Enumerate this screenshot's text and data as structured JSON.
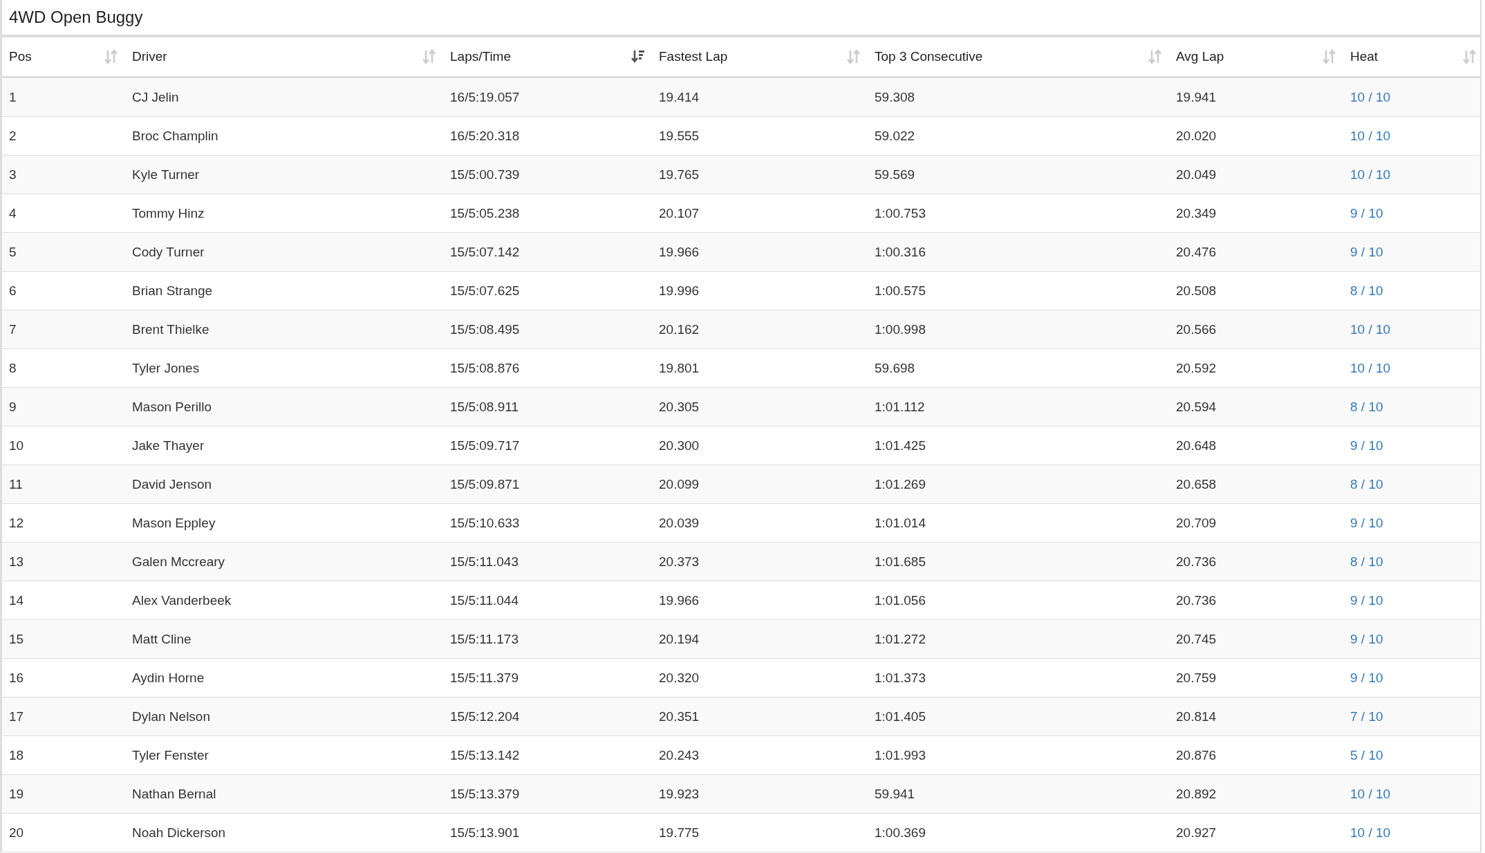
{
  "title": "4WD Open Buggy",
  "columns": [
    {
      "label": "Pos",
      "sorted": false
    },
    {
      "label": "Driver",
      "sorted": false
    },
    {
      "label": "Laps/Time",
      "sorted": true
    },
    {
      "label": "Fastest Lap",
      "sorted": false
    },
    {
      "label": "Top 3 Consecutive",
      "sorted": false
    },
    {
      "label": "Avg Lap",
      "sorted": false
    },
    {
      "label": "Heat",
      "sorted": false
    }
  ],
  "rows": [
    [
      "1",
      "CJ Jelin",
      "16/5:19.057",
      "19.414",
      "59.308",
      "19.941",
      "10 / 10"
    ],
    [
      "2",
      "Broc Champlin",
      "16/5:20.318",
      "19.555",
      "59.022",
      "20.020",
      "10 / 10"
    ],
    [
      "3",
      "Kyle Turner",
      "15/5:00.739",
      "19.765",
      "59.569",
      "20.049",
      "10 / 10"
    ],
    [
      "4",
      "Tommy Hinz",
      "15/5:05.238",
      "20.107",
      "1:00.753",
      "20.349",
      "9 / 10"
    ],
    [
      "5",
      "Cody Turner",
      "15/5:07.142",
      "19.966",
      "1:00.316",
      "20.476",
      "9 / 10"
    ],
    [
      "6",
      "Brian Strange",
      "15/5:07.625",
      "19.996",
      "1:00.575",
      "20.508",
      "8 / 10"
    ],
    [
      "7",
      "Brent Thielke",
      "15/5:08.495",
      "20.162",
      "1:00.998",
      "20.566",
      "10 / 10"
    ],
    [
      "8",
      "Tyler Jones",
      "15/5:08.876",
      "19.801",
      "59.698",
      "20.592",
      "10 / 10"
    ],
    [
      "9",
      "Mason Perillo",
      "15/5:08.911",
      "20.305",
      "1:01.112",
      "20.594",
      "8 / 10"
    ],
    [
      "10",
      "Jake Thayer",
      "15/5:09.717",
      "20.300",
      "1:01.425",
      "20.648",
      "9 / 10"
    ],
    [
      "11",
      "David Jenson",
      "15/5:09.871",
      "20.099",
      "1:01.269",
      "20.658",
      "8 / 10"
    ],
    [
      "12",
      "Mason Eppley",
      "15/5:10.633",
      "20.039",
      "1:01.014",
      "20.709",
      "9 / 10"
    ],
    [
      "13",
      "Galen Mccreary",
      "15/5:11.043",
      "20.373",
      "1:01.685",
      "20.736",
      "8 / 10"
    ],
    [
      "14",
      "Alex Vanderbeek",
      "15/5:11.044",
      "19.966",
      "1:01.056",
      "20.736",
      "9 / 10"
    ],
    [
      "15",
      "Matt Cline",
      "15/5:11.173",
      "20.194",
      "1:01.272",
      "20.745",
      "9 / 10"
    ],
    [
      "16",
      "Aydin Horne",
      "15/5:11.379",
      "20.320",
      "1:01.373",
      "20.759",
      "9 / 10"
    ],
    [
      "17",
      "Dylan Nelson",
      "15/5:12.204",
      "20.351",
      "1:01.405",
      "20.814",
      "7 / 10"
    ],
    [
      "18",
      "Tyler Fenster",
      "15/5:13.142",
      "20.243",
      "1:01.993",
      "20.876",
      "5 / 10"
    ],
    [
      "19",
      "Nathan Bernal",
      "15/5:13.379",
      "19.923",
      "59.941",
      "20.892",
      "10 / 10"
    ],
    [
      "20",
      "Noah Dickerson",
      "15/5:13.901",
      "19.775",
      "1:00.369",
      "20.927",
      "10 / 10"
    ]
  ]
}
